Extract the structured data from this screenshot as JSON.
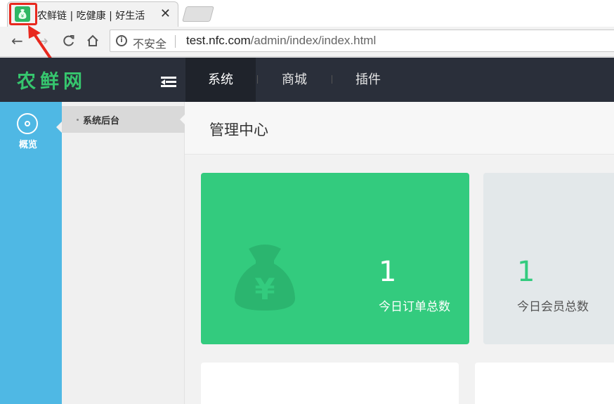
{
  "browser": {
    "tab_title": "农鲜链 | 吃健康 | 好生活",
    "tab_close": "✕",
    "back": "←",
    "forward": "→",
    "reload": "C",
    "home": "⌂",
    "security_label": "不安全",
    "url_host": "test.nfc.com",
    "url_path": "/admin/index/index.html"
  },
  "header": {
    "logo": "农鲜网",
    "nav": [
      {
        "label": "系统",
        "active": true
      },
      {
        "label": "商城",
        "active": false
      },
      {
        "label": "插件",
        "active": false
      }
    ]
  },
  "left_rail": {
    "items": [
      {
        "label": "概览",
        "icon": "dashboard-icon"
      }
    ]
  },
  "sub_nav": {
    "items": [
      {
        "label": "系统后台"
      }
    ]
  },
  "main": {
    "title": "管理中心",
    "stats": [
      {
        "value": "1",
        "label": "今日订单总数",
        "icon": "money-bag-icon"
      },
      {
        "value": "1",
        "label": "今日会员总数"
      }
    ]
  },
  "colors": {
    "accent_green": "#33cb7e",
    "rail_blue": "#4fb8e4",
    "header_dark": "#2a2f3a",
    "annotation_red": "#e8281e"
  }
}
